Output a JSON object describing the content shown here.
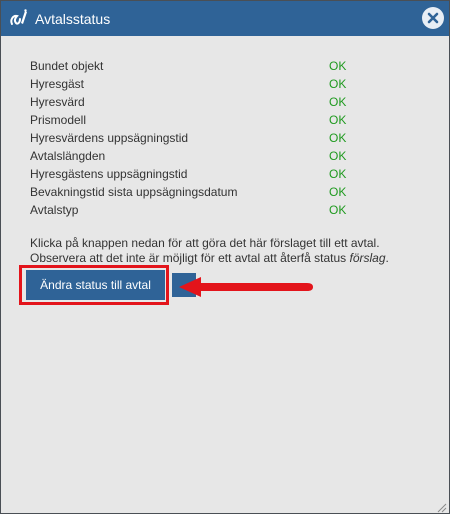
{
  "dialog": {
    "title": "Avtalsstatus",
    "colors": {
      "titlebar": "#2f6397",
      "ok": "#1f9a1f",
      "highlight": "#e3141b",
      "background": "#e7e7e7"
    }
  },
  "status_items": [
    {
      "label": "Bundet objekt",
      "status": "OK"
    },
    {
      "label": "Hyresgäst",
      "status": "OK"
    },
    {
      "label": "Hyresvärd",
      "status": "OK"
    },
    {
      "label": "Prismodell",
      "status": "OK"
    },
    {
      "label": "Hyresvärdens uppsägningstid",
      "status": "OK"
    },
    {
      "label": "Avtalslängden",
      "status": "OK"
    },
    {
      "label": "Hyresgästens uppsägningstid",
      "status": "OK"
    },
    {
      "label": "Bevakningstid sista uppsägningsdatum",
      "status": "OK"
    },
    {
      "label": "Avtalstyp",
      "status": "OK"
    }
  ],
  "info": {
    "line1": "Klicka på knappen nedan för att göra det här förslaget till ett avtal.",
    "line2_prefix": "Observera att det inte är möjligt för ett avtal att återfå status ",
    "line2_emphasis": "förslag",
    "line2_suffix": "."
  },
  "actions": {
    "change_status_label": "Ändra status till avtal"
  },
  "icons": {
    "app": "contract-signature-icon",
    "close": "close-icon",
    "arrow": "arrow-left-icon",
    "resize": "resize-grip-icon"
  }
}
